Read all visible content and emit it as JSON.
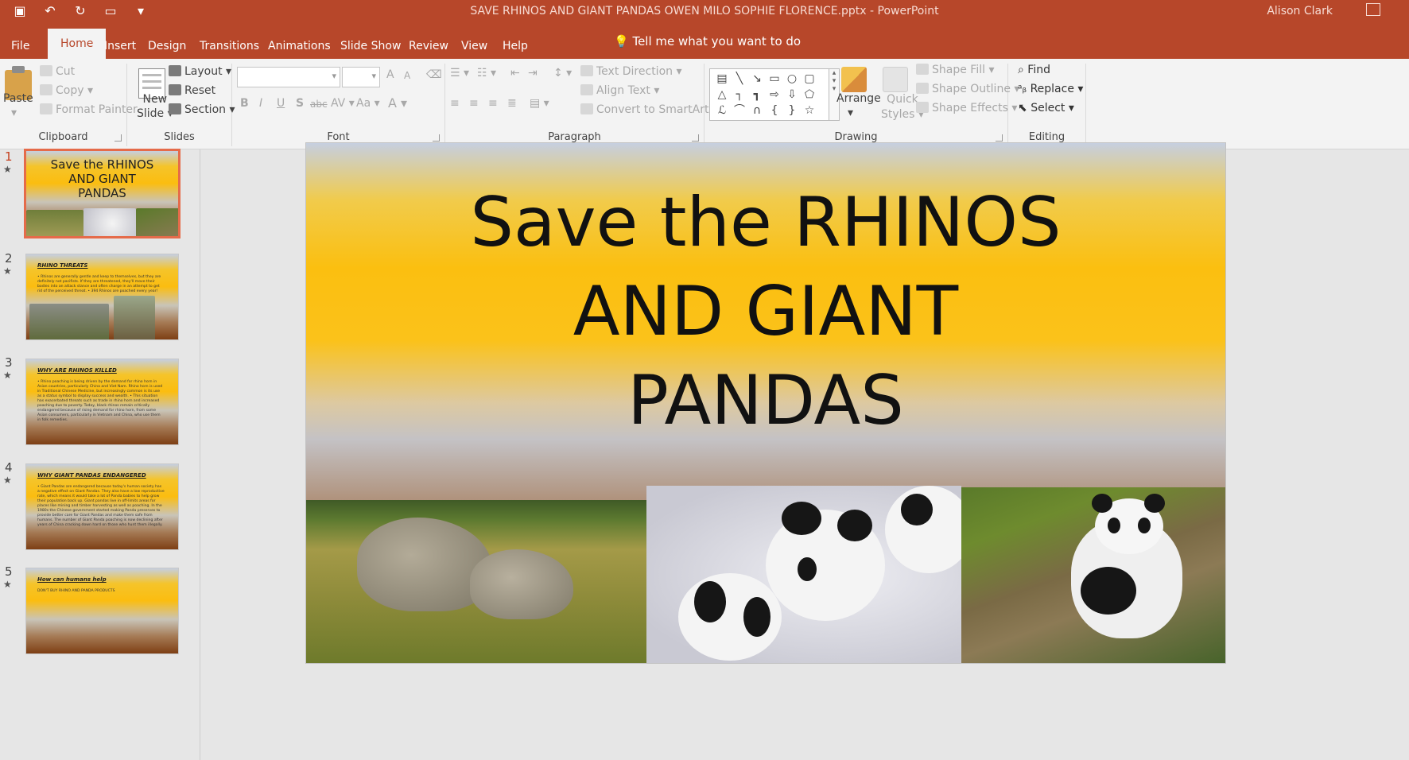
{
  "window": {
    "title": "SAVE RHINOS AND GIANT PANDAS OWEN MILO  SOPHIE FLORENCE.pptx  -  PowerPoint",
    "user": "Alison Clark"
  },
  "qat": {
    "save_icon": "save-icon",
    "undo_icon": "undo-icon",
    "redo_icon": "repeat-icon",
    "present_icon": "start-from-beginning-icon",
    "customize": "▾"
  },
  "tabs": [
    "File",
    "Home",
    "Insert",
    "Design",
    "Transitions",
    "Animations",
    "Slide Show",
    "Review",
    "View",
    "Help"
  ],
  "tell_me": "Tell me what you want to do",
  "ribbon": {
    "clipboard": {
      "paste": "Paste",
      "cut": "Cut",
      "copy": "Copy",
      "format_painter": "Format Painter",
      "label": "Clipboard"
    },
    "slides": {
      "new_slide_1": "New",
      "new_slide_2": "Slide",
      "layout": "Layout",
      "reset": "Reset",
      "section": "Section",
      "label": "Slides"
    },
    "font": {
      "label": "Font",
      "bold": "B",
      "italic": "I",
      "underline": "U",
      "shadow": "S",
      "strike": "abc",
      "spacing": "AV",
      "case": "Aa",
      "color": "A",
      "grow": "A",
      "shrink": "A"
    },
    "paragraph": {
      "text_direction": "Text Direction",
      "align_text": "Align Text",
      "smartart": "Convert to SmartArt",
      "label": "Paragraph"
    },
    "drawing": {
      "arrange": "Arrange",
      "quick_styles_1": "Quick",
      "quick_styles_2": "Styles",
      "shape_fill": "Shape Fill",
      "shape_outline": "Shape Outline",
      "shape_effects": "Shape Effects",
      "label": "Drawing"
    },
    "editing": {
      "find": "Find",
      "replace": "Replace",
      "select": "Select",
      "label": "Editing"
    }
  },
  "slides": [
    {
      "num": "1",
      "title_lines": [
        "Save the RHINOS",
        "AND GIANT",
        "PANDAS"
      ]
    },
    {
      "num": "2",
      "title": "RHINO THREATS",
      "body": "• Rhinos are generally gentle and keep to themselves, but they are definitely not pacifists. If they are threatened, they'll move their bodies into an attack stance and often charge in an attempt to get rid of the perceived threat. • 394 Rhinos are poached every year!"
    },
    {
      "num": "3",
      "title": "WHY ARE RHINOS KILLED",
      "body": "• Rhino poaching is being driven by the demand for rhino horn in Asian countries, particularly China and Viet Nam. Rhino horn is used in Traditional Chinese Medicine, but increasingly common is its use as a status symbol to display success and wealth. • This situation has exacerbated threats such as trade in rhino horn and increased poaching due to poverty. Today, black rhinos remain critically endangered because of rising demand for rhino horn, from some Asian consumers, particularly in Vietnam and China, who use them in folk remedies."
    },
    {
      "num": "4",
      "title": "WHY GIANT PANDAS ENDANGERED",
      "body": "• Giant Pandas are endangered because today's human society has a negative effect on Giant Pandas. They also have a low reproductive rate, which means it would take a lot of Panda babies to help grow their population back up. Giant pandas live in off-limits areas for places like mining and timber harvesting as well as poaching. In the 1980s the Chinese government started making Panda preserves to provide better care for Giant Pandas and make them safe from humans. The number of Giant Panda poaching is now declining after years of China cracking down hard on those who hunt them illegally."
    },
    {
      "num": "5",
      "title": "How can humans help",
      "body": "DON'T BUY RHINO AND PANDA PRODUCTS"
    }
  ],
  "slide_star": "★",
  "main_slide": {
    "title_lines": [
      "Save the RHINOS",
      "AND GIANT",
      "PANDAS"
    ]
  }
}
